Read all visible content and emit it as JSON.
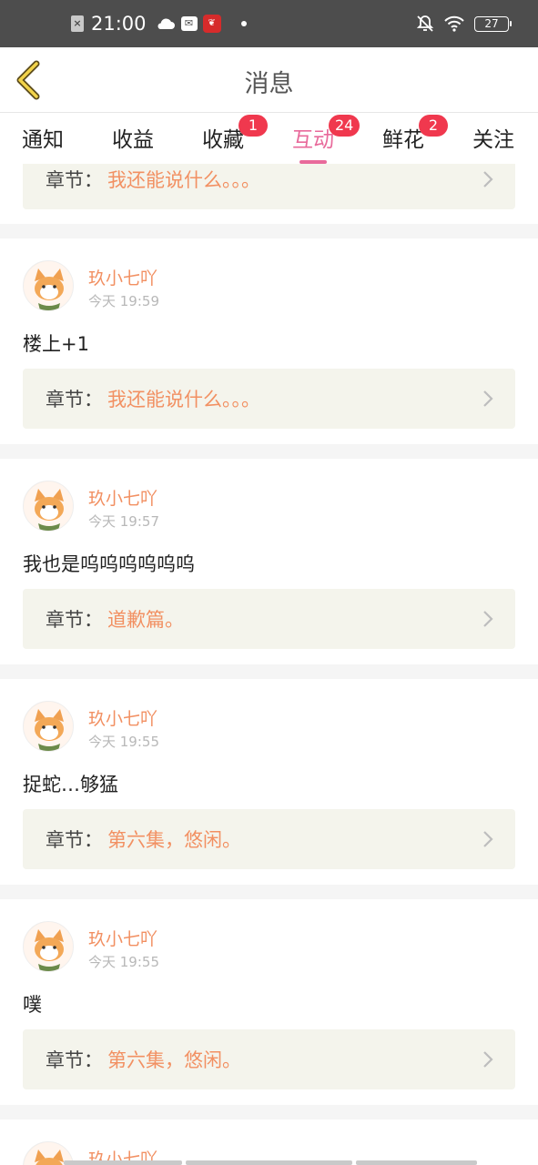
{
  "status_bar": {
    "time": "21:00",
    "battery": "27",
    "icons": [
      "sim-off-icon",
      "cloud-icon",
      "mail-icon",
      "app-notification-icon",
      "dot-icon",
      "bell-off-icon",
      "wifi-icon",
      "battery-icon"
    ]
  },
  "header": {
    "title": "消息",
    "back_icon": "chevron-left-icon"
  },
  "tabs": [
    {
      "label": "通知",
      "badge": null,
      "active": false
    },
    {
      "label": "收益",
      "badge": null,
      "active": false
    },
    {
      "label": "收藏",
      "badge": "1",
      "active": false
    },
    {
      "label": "互动",
      "badge": "24",
      "active": true
    },
    {
      "label": "鲜花",
      "badge": "2",
      "active": false
    },
    {
      "label": "关注",
      "badge": null,
      "active": false
    }
  ],
  "feed": {
    "chapter_prefix": "章节：",
    "partial_top": {
      "chapter": "我还能说什么。。。"
    },
    "items": [
      {
        "user": "玖小七吖",
        "time": "今天 19:59",
        "comment": "楼上+1",
        "chapter": "我还能说什么。。。"
      },
      {
        "user": "玖小七吖",
        "time": "今天 19:57",
        "comment": "我也是呜呜呜呜呜呜",
        "chapter": "道歉篇。"
      },
      {
        "user": "玖小七吖",
        "time": "今天 19:55",
        "comment": "捉蛇…够猛",
        "chapter": "第六集，悠闲。"
      },
      {
        "user": "玖小七吖",
        "time": "今天 19:55",
        "comment": "噗",
        "chapter": "第六集，悠闲。"
      }
    ],
    "partial_bottom": {
      "user": "玖小七吖"
    }
  }
}
